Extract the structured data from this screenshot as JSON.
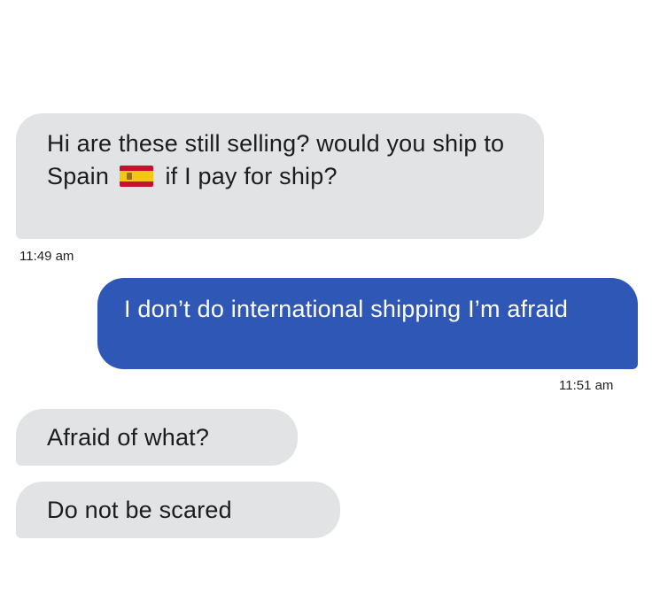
{
  "messages": [
    {
      "direction": "incoming",
      "text_before_flag": "Hi are these still selling? would you ship to Spain",
      "flag_icon": "spain-flag-icon",
      "text_after_flag": "if I pay for ship?"
    },
    {
      "direction": "outgoing",
      "text": "I don’t do international shipping I’m afraid"
    },
    {
      "direction": "incoming",
      "text": "Afraid of what?"
    },
    {
      "direction": "incoming",
      "text": "Do not be scared"
    }
  ],
  "timestamps": {
    "first": "11:49 am",
    "second": "11:51 am"
  },
  "colors": {
    "incoming_bubble": "#e2e3e5",
    "outgoing_bubble": "#2f57b5",
    "background": "#ffffff"
  }
}
